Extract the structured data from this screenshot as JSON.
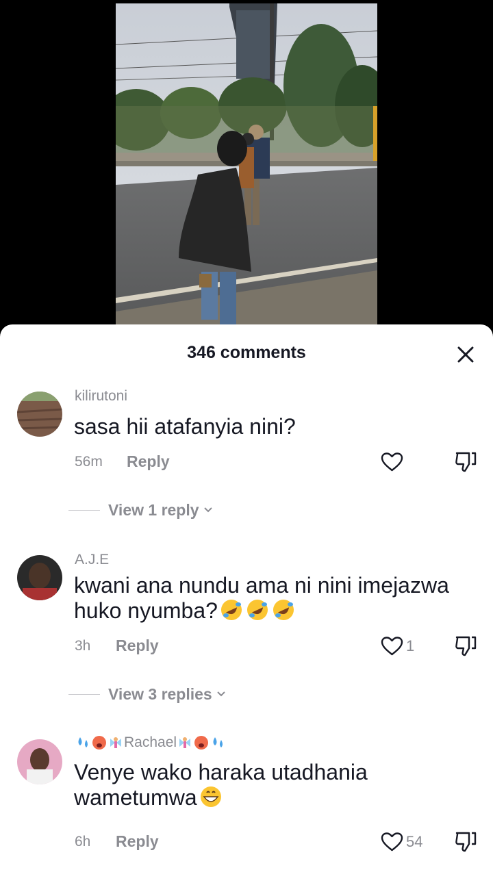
{
  "sheet": {
    "comment_count": "346 comments",
    "close_icon": "close-icon"
  },
  "comments": [
    {
      "username": "kilirutoni",
      "text": "sasa hii atafanyia nini?",
      "time": "56m",
      "reply_label": "Reply",
      "likes": "",
      "view_replies": "View 1 reply"
    },
    {
      "username": "A.J.E",
      "text": "kwani ana nundu ama ni nini imejazwa huko nyumba?",
      "text_emojis": [
        "rolling-laughing-emoji",
        "rolling-laughing-emoji",
        "rolling-laughing-emoji"
      ],
      "time": "3h",
      "reply_label": "Reply",
      "likes": "1",
      "view_replies": "View 3 replies"
    },
    {
      "username": "Rachael",
      "username_emojis_left": [
        "sweat-droplets-emoji",
        "hot-face-emoji",
        "fairy-emoji"
      ],
      "username_emojis_right": [
        "fairy-emoji",
        "hot-face-emoji",
        "sweat-droplets-emoji"
      ],
      "text": "Venye wako haraka utadhania wametumwa",
      "text_emojis": [
        "grinning-face-emoji"
      ],
      "time": "6h",
      "reply_label": "Reply",
      "likes": "54"
    }
  ],
  "colors": {
    "text_primary": "#161823",
    "text_secondary": "#8a8b91",
    "sheet_bg": "#ffffff",
    "video_bg": "#000000"
  }
}
